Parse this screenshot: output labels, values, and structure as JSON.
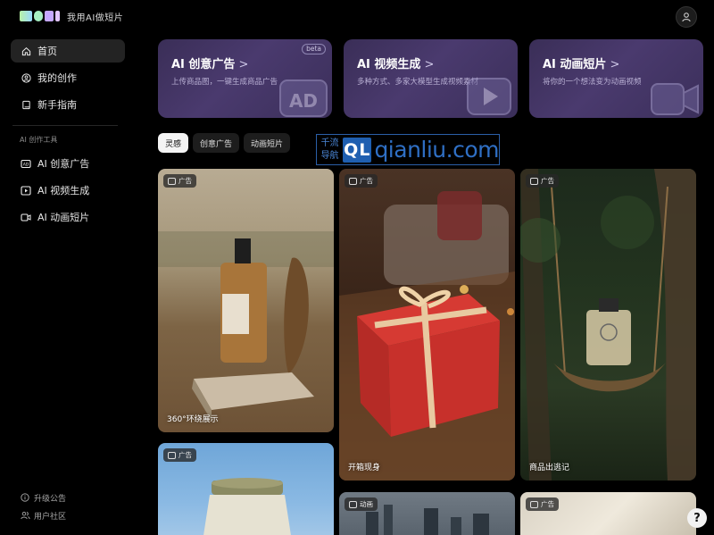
{
  "brand": {
    "logo_text": "MOKI",
    "tagline": "我用AI做短片"
  },
  "sidebar": {
    "items": [
      {
        "label": "首页",
        "icon": "home-icon",
        "active": true
      },
      {
        "label": "我的创作",
        "icon": "user-circle-icon",
        "active": false
      },
      {
        "label": "新手指南",
        "icon": "book-icon",
        "active": false
      }
    ],
    "section_label": "AI 创作工具",
    "tools": [
      {
        "label": "AI 创意广告",
        "icon": "ad-icon"
      },
      {
        "label": "AI 视频生成",
        "icon": "play-icon"
      },
      {
        "label": "AI 动画短片",
        "icon": "video-camera-icon"
      }
    ],
    "bottom": [
      {
        "label": "升级公告",
        "icon": "info-icon"
      },
      {
        "label": "用户社区",
        "icon": "users-icon"
      }
    ]
  },
  "features": [
    {
      "title": "AI 创意广告",
      "subtitle": "上传商品图，一键生成商品广告",
      "beta": "beta"
    },
    {
      "title": "AI 视频生成",
      "subtitle": "多种方式、多家大模型生成视频素材"
    },
    {
      "title": "AI 动画短片",
      "subtitle": "将你的一个想法变为动画视频"
    }
  ],
  "feature_chevron": ">",
  "feature_art_text": "AD",
  "tabs": [
    {
      "label": "灵感",
      "active": true
    },
    {
      "label": "创意广告",
      "active": false
    },
    {
      "label": "动画短片",
      "active": false
    }
  ],
  "watermark": {
    "cn_top": "千流",
    "cn_bottom": "导航",
    "mark": "QL",
    "domain": "qianliu.com"
  },
  "cards": [
    {
      "badge": "广告",
      "caption": "360°环绕展示"
    },
    {
      "badge": "广告",
      "caption": "开箱现身"
    },
    {
      "badge": "广告",
      "caption": "商品出逃记"
    },
    {
      "badge": "广告",
      "caption": ""
    },
    {
      "badge": "动画",
      "caption": ""
    },
    {
      "badge": "广告",
      "caption": ""
    }
  ],
  "help_label": "?",
  "colors": {
    "accent_card": "#3f3262",
    "active_tab": "#f4f4f4",
    "sidebar_active": "#232323"
  }
}
